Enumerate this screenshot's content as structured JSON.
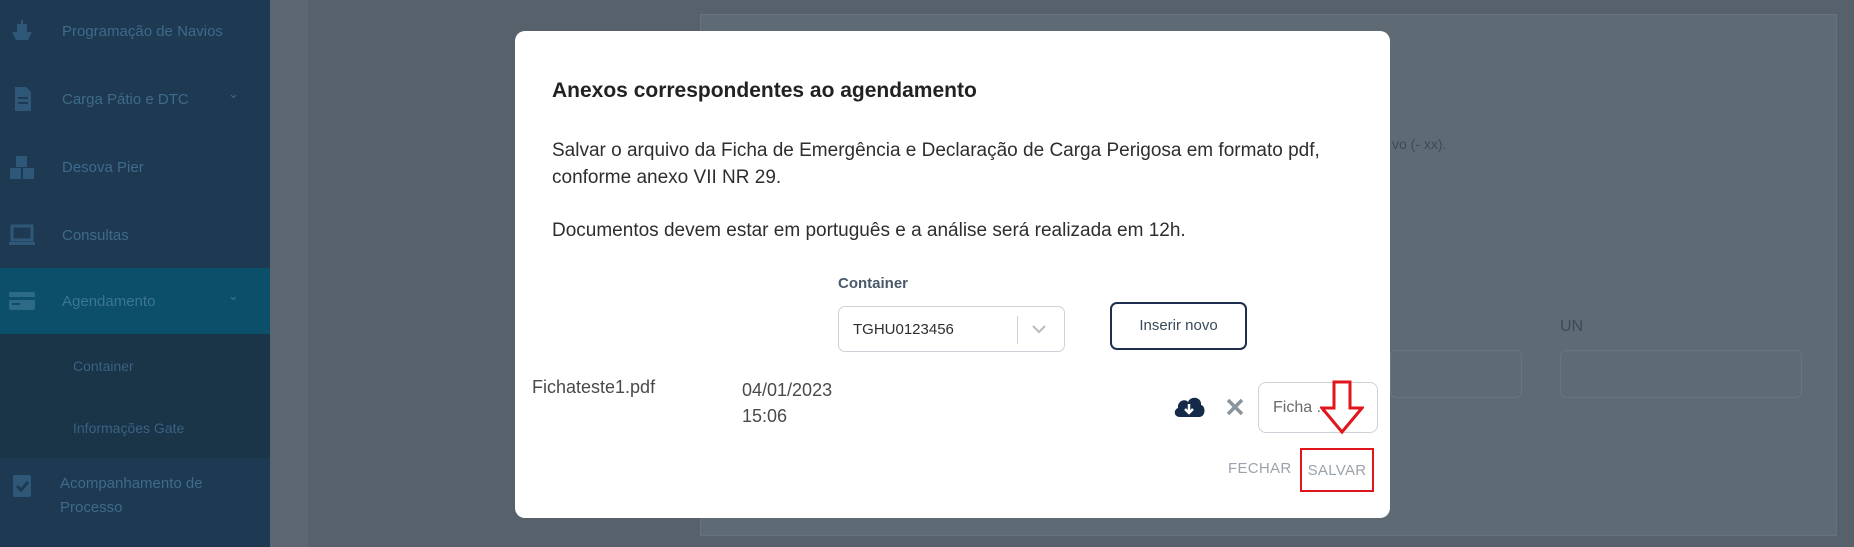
{
  "sidebar": {
    "items": [
      {
        "label": "Programação de Navios",
        "icon": "ship-icon"
      },
      {
        "label": "Carga Pátio e DTC",
        "icon": "document-icon",
        "chevron": "⌄"
      },
      {
        "label": "Desova Pier",
        "icon": "boxes-icon"
      },
      {
        "label": "Consultas",
        "icon": "laptop-icon"
      },
      {
        "label": "Agendamento",
        "icon": "card-icon",
        "chevron": "⌄"
      },
      {
        "label": "Acompanhamento de Processo",
        "icon": "clipboard-check-icon"
      }
    ],
    "subitems": [
      "Container",
      "Informações Gate"
    ]
  },
  "background": {
    "partial_text": "vo (- xx).",
    "un_label": "UN"
  },
  "modal": {
    "title": "Anexos correspondentes ao agendamento",
    "paragraph1": "Salvar o arquivo da Ficha de Emergência e Declaração de Carga Perigosa em formato pdf, conforme anexo VII NR 29.",
    "paragraph2": "Documentos devem estar em português e a análise será realizada em 12h.",
    "container_label": "Container",
    "container_value": "TGHU0123456",
    "insert_new_label": "Inserir novo",
    "file": {
      "name": "Fichateste1.pdf",
      "date": "04/01/2023",
      "time": "15:06",
      "type_input_value": "Ficha ..."
    },
    "close_label": "FECHAR",
    "save_label": "SALVAR"
  },
  "colors": {
    "highlight": "#e0161c",
    "button_border": "#1d2e4e"
  }
}
